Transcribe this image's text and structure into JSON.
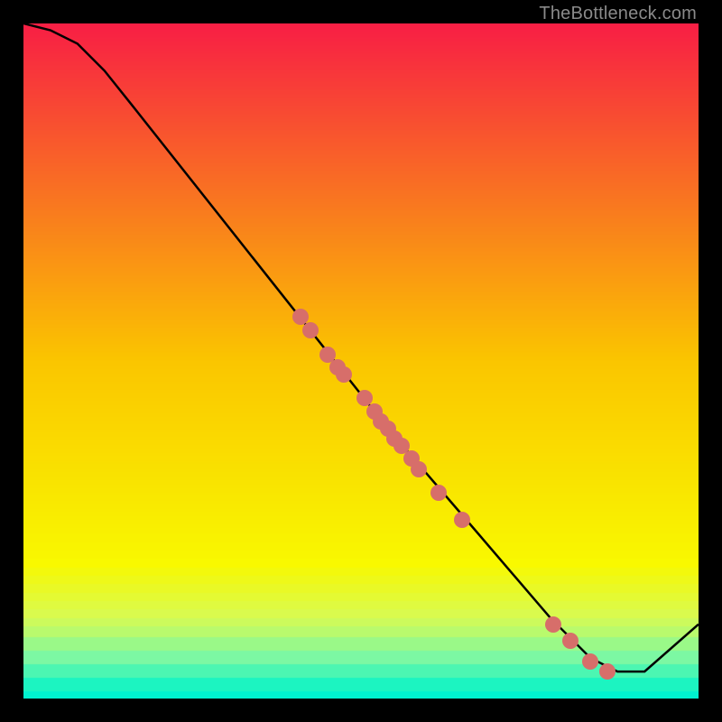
{
  "watermark": "TheBottleneck.com",
  "colors": {
    "dot": "#d76e6a",
    "curve": "#000000"
  },
  "chart_data": {
    "type": "line",
    "title": "",
    "xlabel": "",
    "ylabel": "",
    "xlim": [
      0,
      100
    ],
    "ylim": [
      0,
      100
    ],
    "grid": false,
    "background_gradient": {
      "direction": "top-to-bottom",
      "stops": [
        {
          "pos": 0.0,
          "color": "#f81f45"
        },
        {
          "pos": 0.5,
          "color": "#fbc600"
        },
        {
          "pos": 0.8,
          "color": "#f9f900"
        },
        {
          "pos": 0.88,
          "color": "#d8fb53"
        },
        {
          "pos": 0.94,
          "color": "#7cf8a3"
        },
        {
          "pos": 0.98,
          "color": "#1cf4c1"
        },
        {
          "pos": 1.0,
          "color": "#00f2cf"
        }
      ]
    },
    "series": [
      {
        "name": "bottleneck-curve",
        "x": [
          0,
          4,
          8,
          12,
          16,
          54,
          60,
          66,
          72,
          78,
          84,
          88,
          92,
          100
        ],
        "y": [
          100,
          99,
          97,
          93,
          88,
          40,
          33,
          26,
          19,
          12,
          6,
          4,
          4,
          11
        ]
      }
    ],
    "points": [
      {
        "name": "p1",
        "x": 41.0,
        "y": 56.5
      },
      {
        "name": "p2",
        "x": 42.5,
        "y": 54.5
      },
      {
        "name": "p3",
        "x": 45.0,
        "y": 51.0
      },
      {
        "name": "p4",
        "x": 46.5,
        "y": 49.0
      },
      {
        "name": "p5",
        "x": 47.5,
        "y": 48.0
      },
      {
        "name": "p6",
        "x": 50.5,
        "y": 44.5
      },
      {
        "name": "p7",
        "x": 52.0,
        "y": 42.5
      },
      {
        "name": "p8",
        "x": 53.0,
        "y": 41.0
      },
      {
        "name": "p9",
        "x": 54.0,
        "y": 40.0
      },
      {
        "name": "p10",
        "x": 55.0,
        "y": 38.5
      },
      {
        "name": "p11",
        "x": 56.0,
        "y": 37.5
      },
      {
        "name": "p12",
        "x": 57.5,
        "y": 35.5
      },
      {
        "name": "p13",
        "x": 58.5,
        "y": 34.0
      },
      {
        "name": "p14",
        "x": 61.5,
        "y": 30.5
      },
      {
        "name": "p15",
        "x": 65.0,
        "y": 26.5
      },
      {
        "name": "p16",
        "x": 78.5,
        "y": 11.0
      },
      {
        "name": "p17",
        "x": 81.0,
        "y": 8.5
      },
      {
        "name": "p18",
        "x": 84.0,
        "y": 5.5
      },
      {
        "name": "p19",
        "x": 86.5,
        "y": 4.0
      }
    ]
  }
}
